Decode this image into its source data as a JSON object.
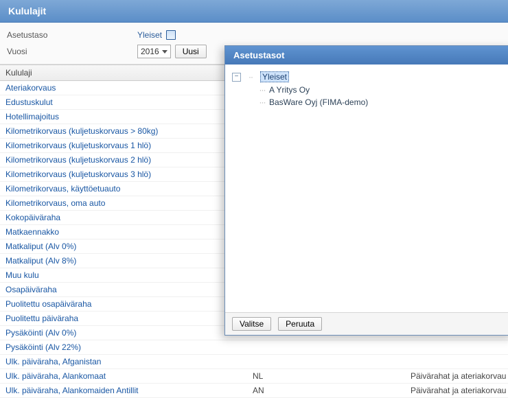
{
  "header": {
    "title": "Kululajit"
  },
  "controls": {
    "level_label": "Asetustaso",
    "level_value": "Yleiset",
    "year_label": "Vuosi",
    "year_value": "2016",
    "new_btn": "Uusi"
  },
  "list_header": "Kululaji",
  "rows": [
    {
      "name": "Ateriakorvaus"
    },
    {
      "name": "Edustuskulut"
    },
    {
      "name": "Hotellimajoitus"
    },
    {
      "name": "Kilometrikorvaus (kuljetuskorvaus > 80kg)"
    },
    {
      "name": "Kilometrikorvaus (kuljetuskorvaus 1 hlö)"
    },
    {
      "name": "Kilometrikorvaus (kuljetuskorvaus 2 hlö)"
    },
    {
      "name": "Kilometrikorvaus (kuljetuskorvaus 3 hlö)"
    },
    {
      "name": "Kilometrikorvaus, käyttöetuauto"
    },
    {
      "name": "Kilometrikorvaus, oma auto"
    },
    {
      "name": "Kokopäiväraha"
    },
    {
      "name": "Matkaennakko"
    },
    {
      "name": "Matkaliput (Alv 0%)"
    },
    {
      "name": "Matkaliput (Alv 8%)"
    },
    {
      "name": "Muu kulu"
    },
    {
      "name": "Osapäiväraha"
    },
    {
      "name": "Puolitettu osapäiväraha"
    },
    {
      "name": "Puolitettu päiväraha"
    },
    {
      "name": "Pysäköinti (Alv 0%)"
    },
    {
      "name": "Pysäköinti (Alv 22%)"
    },
    {
      "name": "Ulk. päiväraha, Afganistan"
    },
    {
      "name": "Ulk. päiväraha, Alankomaat",
      "code": "NL",
      "group": "Päivärahat ja ateriakorvau"
    },
    {
      "name": "Ulk. päiväraha, Alankomaiden Antillit",
      "code": "AN",
      "group": "Päivärahat ja ateriakorvau"
    }
  ],
  "modal": {
    "title": "Asetustasot",
    "root": "Yleiset",
    "children": [
      "A Yritys Oy",
      "BasWare Oyj (FIMA-demo)"
    ],
    "select_btn": "Valitse",
    "cancel_btn": "Peruuta"
  }
}
